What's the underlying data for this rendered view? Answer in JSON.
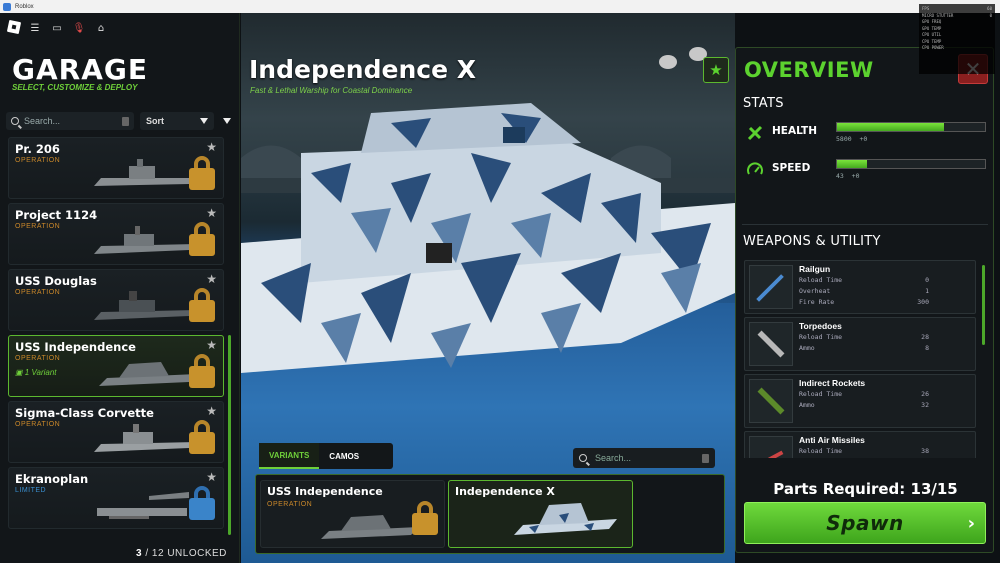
{
  "window": {
    "title": "Roblox"
  },
  "left_panel": {
    "title": "GARAGE",
    "subtitle": "SELECT, CUSTOMIZE & DEPLOY",
    "search_placeholder": "Search...",
    "sort_label": "Sort",
    "ships": [
      {
        "name": "Pr. 206",
        "tag": "OPERATION",
        "locked": true
      },
      {
        "name": "Project 1124",
        "tag": "OPERATION",
        "locked": true
      },
      {
        "name": "USS Douglas",
        "tag": "OPERATION",
        "locked": true
      },
      {
        "name": "USS Independence",
        "tag": "OPERATION",
        "variant": "1 Variant",
        "locked": true,
        "selected": true
      },
      {
        "name": "Sigma-Class Corvette",
        "tag": "OPERATION",
        "locked": true
      },
      {
        "name": "Ekranoplan",
        "tag": "LIMITED",
        "locked": true
      }
    ],
    "unlocked_count": "3",
    "unlocked_total": "/ 12",
    "unlocked_label": "UNLOCKED"
  },
  "center": {
    "ship_title": "Independence X",
    "ship_subtitle": "Fast & Lethal Warship for Coastal Dominance",
    "tabs": [
      "VARIANTS",
      "CAMOS"
    ],
    "active_tab": "VARIANTS",
    "variant_search_placeholder": "Search...",
    "variants": [
      {
        "name": "USS Independence",
        "tag": "OPERATION"
      },
      {
        "name": "Independence X",
        "tag": ""
      }
    ]
  },
  "overview": {
    "title": "OVERVIEW",
    "stats_heading": "STATS",
    "stats": [
      {
        "label": "HEALTH",
        "value": "5800",
        "bonus": "+0",
        "fill": 0.72,
        "icon": "health-icon"
      },
      {
        "label": "SPEED",
        "value": "43",
        "bonus": "+0",
        "fill": 0.2,
        "icon": "speed-icon"
      }
    ],
    "weapons_heading": "WEAPONS & UTILITY",
    "weapons": [
      {
        "name": "Railgun",
        "stats": [
          [
            "Reload Time",
            "0"
          ],
          [
            "Overheat",
            "1"
          ],
          [
            "Fire Rate",
            "300"
          ]
        ]
      },
      {
        "name": "Torpedoes",
        "stats": [
          [
            "Reload Time",
            "28"
          ],
          [
            "Ammo",
            "8"
          ]
        ]
      },
      {
        "name": "Indirect Rockets",
        "stats": [
          [
            "Reload Time",
            "26"
          ],
          [
            "Ammo",
            "32"
          ]
        ]
      },
      {
        "name": "Anti Air Missiles",
        "stats": [
          [
            "Reload Time",
            "38"
          ]
        ]
      }
    ],
    "parts_required": "Parts Required: 13/15",
    "spawn_label": "Spawn"
  },
  "colors": {
    "accent": "#5cd22f",
    "operation": "#c9872a",
    "limited": "#3a8fd0",
    "close": "#8a1f1f"
  }
}
